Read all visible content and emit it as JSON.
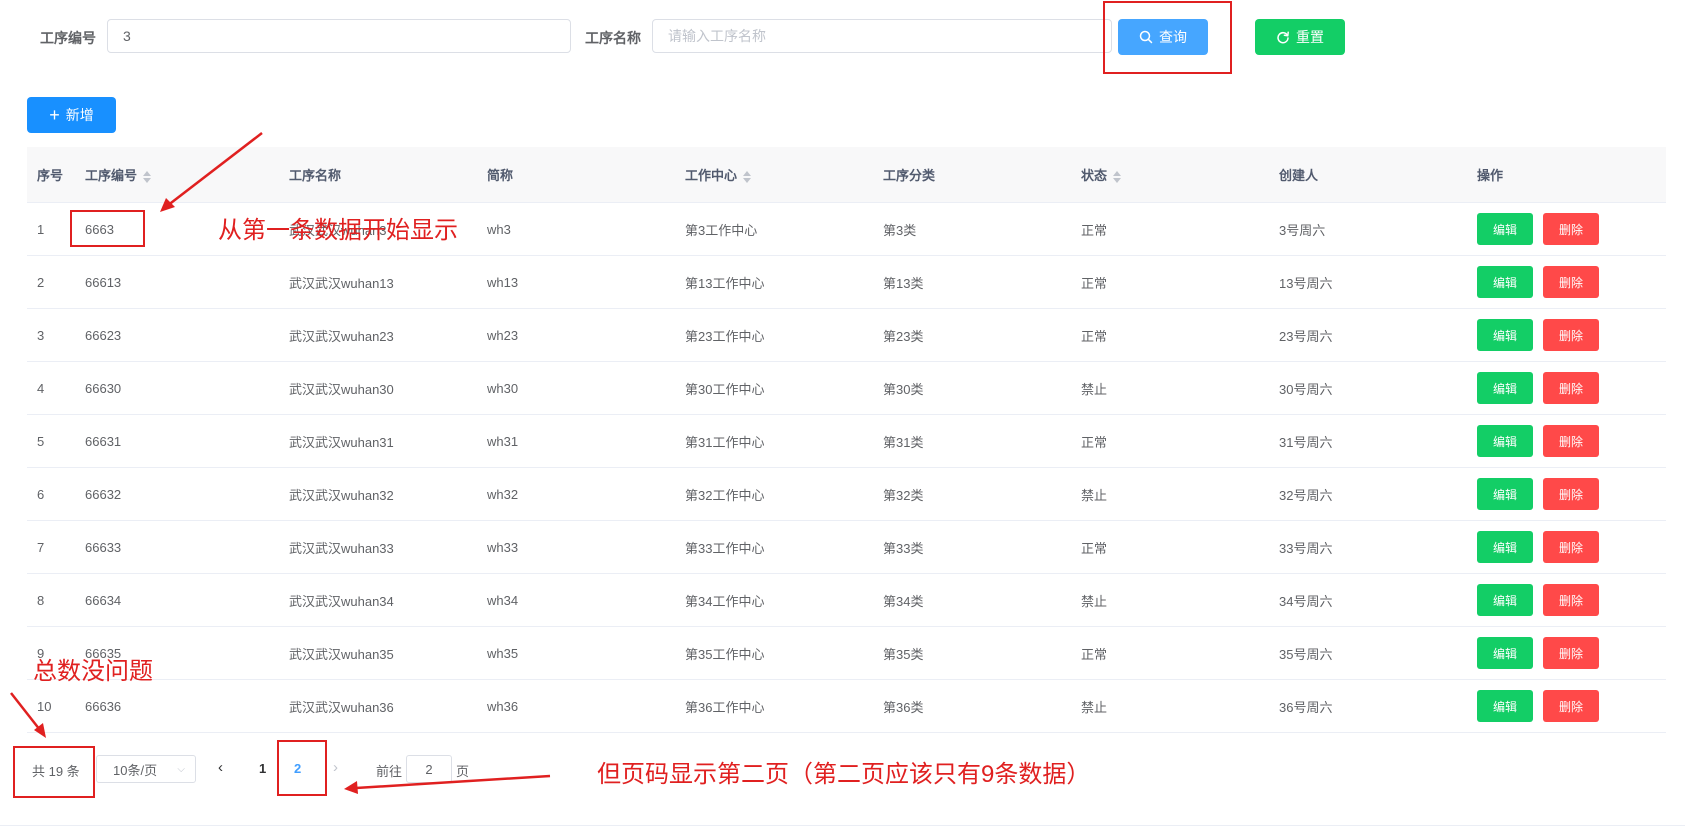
{
  "search": {
    "code_label": "工序编号",
    "code_value": "3",
    "name_label": "工序名称",
    "name_placeholder": "请输入工序名称",
    "query_label": "查询",
    "reset_label": "重置"
  },
  "toolbar": {
    "add_label": "新增"
  },
  "table": {
    "headers": [
      "序号",
      "工序编号",
      "工序名称",
      "简称",
      "工作中心",
      "工序分类",
      "状态",
      "创建人",
      "操作"
    ],
    "edit_label": "编辑",
    "delete_label": "删除",
    "rows": [
      {
        "idx": "1",
        "code": "6663",
        "name": "武汉武汉wuhan3",
        "short": "wh3",
        "center": "第3工作中心",
        "category": "第3类",
        "status": "正常",
        "creator": "3号周六"
      },
      {
        "idx": "2",
        "code": "66613",
        "name": "武汉武汉wuhan13",
        "short": "wh13",
        "center": "第13工作中心",
        "category": "第13类",
        "status": "正常",
        "creator": "13号周六"
      },
      {
        "idx": "3",
        "code": "66623",
        "name": "武汉武汉wuhan23",
        "short": "wh23",
        "center": "第23工作中心",
        "category": "第23类",
        "status": "正常",
        "creator": "23号周六"
      },
      {
        "idx": "4",
        "code": "66630",
        "name": "武汉武汉wuhan30",
        "short": "wh30",
        "center": "第30工作中心",
        "category": "第30类",
        "status": "禁止",
        "creator": "30号周六"
      },
      {
        "idx": "5",
        "code": "66631",
        "name": "武汉武汉wuhan31",
        "short": "wh31",
        "center": "第31工作中心",
        "category": "第31类",
        "status": "正常",
        "creator": "31号周六"
      },
      {
        "idx": "6",
        "code": "66632",
        "name": "武汉武汉wuhan32",
        "short": "wh32",
        "center": "第32工作中心",
        "category": "第32类",
        "status": "禁止",
        "creator": "32号周六"
      },
      {
        "idx": "7",
        "code": "66633",
        "name": "武汉武汉wuhan33",
        "short": "wh33",
        "center": "第33工作中心",
        "category": "第33类",
        "status": "正常",
        "creator": "33号周六"
      },
      {
        "idx": "8",
        "code": "66634",
        "name": "武汉武汉wuhan34",
        "short": "wh34",
        "center": "第34工作中心",
        "category": "第34类",
        "status": "禁止",
        "creator": "34号周六"
      },
      {
        "idx": "9",
        "code": "66635",
        "name": "武汉武汉wuhan35",
        "short": "wh35",
        "center": "第35工作中心",
        "category": "第35类",
        "status": "正常",
        "creator": "35号周六"
      },
      {
        "idx": "10",
        "code": "66636",
        "name": "武汉武汉wuhan36",
        "short": "wh36",
        "center": "第36工作中心",
        "category": "第36类",
        "status": "禁止",
        "creator": "36号周六"
      }
    ]
  },
  "pagination": {
    "total_text": "共 19 条",
    "page_size": "10条/页",
    "pages": [
      "1",
      "2"
    ],
    "current_page": "2",
    "goto_prefix": "前往",
    "goto_value": "2",
    "goto_suffix": "页"
  },
  "annotations": {
    "first_row_note": "从第一条数据开始显示",
    "total_note": "总数没问题",
    "page_note": "但页码显示第二页（第二页应该只有9条数据）"
  },
  "colors": {
    "primary": "#1890ff",
    "query": "#46a6ff",
    "success": "#13ce66",
    "danger": "#ff4949",
    "annotation": "#e02020"
  }
}
